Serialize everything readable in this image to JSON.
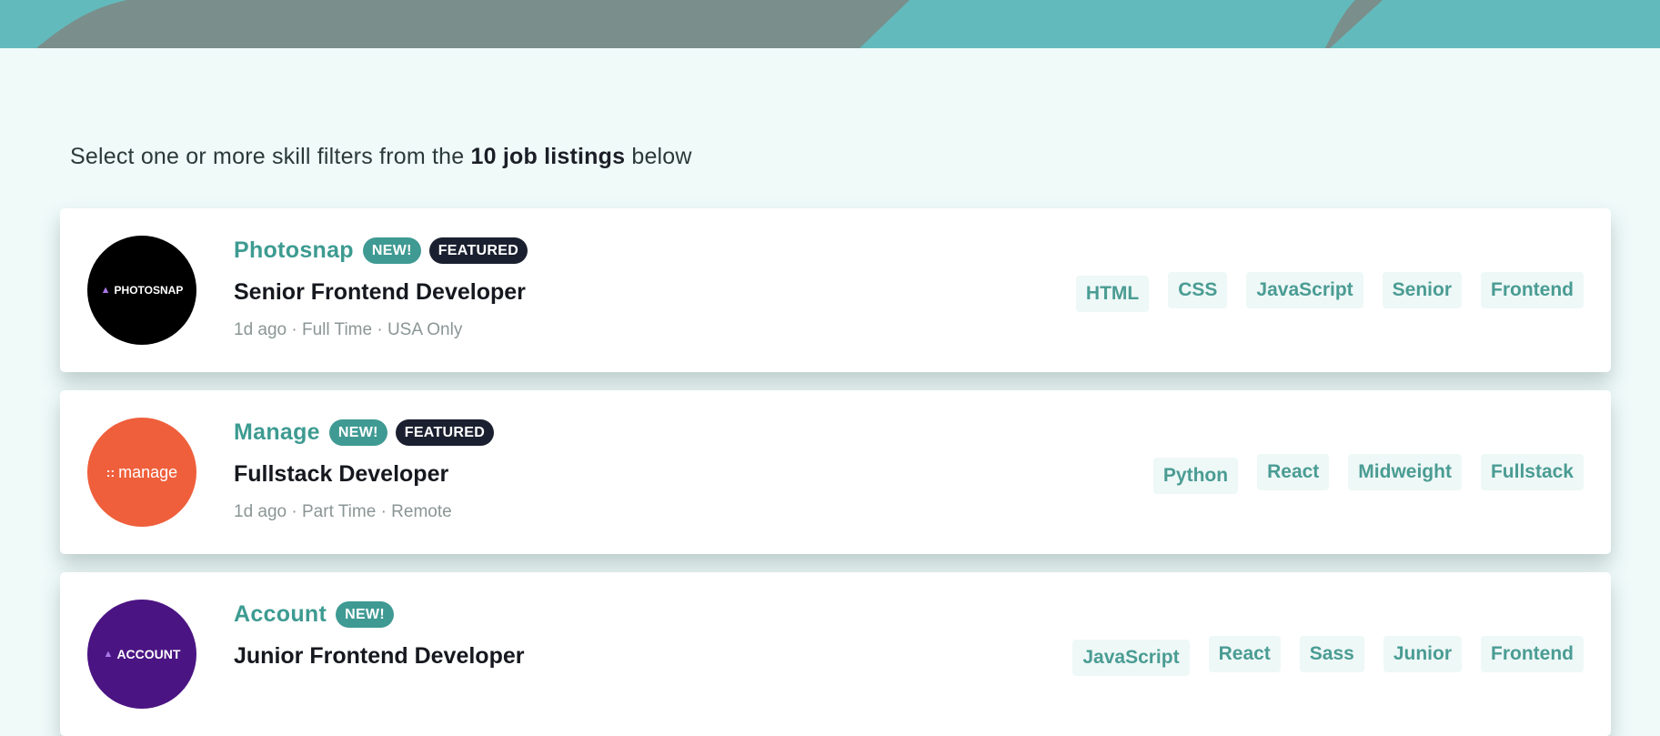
{
  "subtitle": {
    "prefix": "Select one or more skill filters from the ",
    "count": "10 job listings",
    "suffix": " below"
  },
  "colors": {
    "header_bg": "#63babc",
    "header_accent": "#7a8e8b",
    "page_bg": "#effaf9",
    "primary": "#3d9b91",
    "dark": "#1b2030"
  },
  "jobs": [
    {
      "company": "Photosnap",
      "logo_text": "PHOTOSNAP",
      "logo_color": "#000000",
      "new": "NEW!",
      "featured": "FEATURED",
      "position": "Senior Frontend Developer",
      "meta": "1d ago · Full Time · USA Only",
      "tags": [
        "HTML",
        "CSS",
        "JavaScript",
        "Senior",
        "Frontend"
      ]
    },
    {
      "company": "Manage",
      "logo_text": "manage",
      "logo_color": "#ef5f3c",
      "new": "NEW!",
      "featured": "FEATURED",
      "position": "Fullstack Developer",
      "meta": "1d ago · Part Time · Remote",
      "tags": [
        "Python",
        "React",
        "Midweight",
        "Fullstack"
      ]
    },
    {
      "company": "Account",
      "logo_text": "ACCOUNT",
      "logo_color": "#4b1483",
      "new": "NEW!",
      "position": "Junior Frontend Developer",
      "tags": [
        "JavaScript",
        "React",
        "Sass",
        "Junior",
        "Frontend"
      ]
    }
  ]
}
